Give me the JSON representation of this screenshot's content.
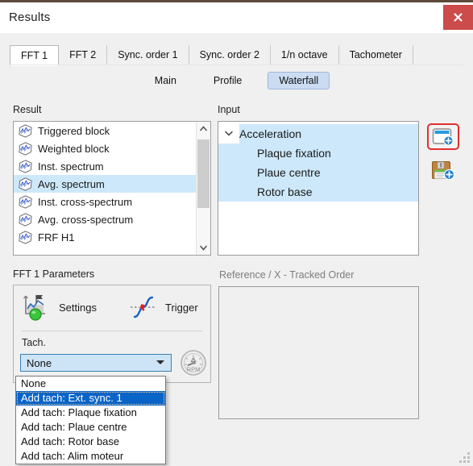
{
  "window": {
    "title": "Results",
    "close_label": "✖",
    "close_icon": "close-icon",
    "accent_red": "#cc4b4b",
    "accent_blue": "#0a64c8",
    "selection_blue": "#cde8fa"
  },
  "tabs": [
    {
      "label": "FFT 1",
      "active": true
    },
    {
      "label": "FFT 2",
      "active": false
    },
    {
      "label": "Sync. order 1",
      "active": false
    },
    {
      "label": "Sync. order 2",
      "active": false
    },
    {
      "label": "1/n octave",
      "active": false
    },
    {
      "label": "Tachometer",
      "active": false
    }
  ],
  "subtabs": [
    {
      "label": "Main",
      "active": false
    },
    {
      "label": "Profile",
      "active": false
    },
    {
      "label": "Waterfall",
      "active": true
    }
  ],
  "result": {
    "label": "Result",
    "items": [
      {
        "label": "Triggered block",
        "selected": false
      },
      {
        "label": "Weighted block",
        "selected": false
      },
      {
        "label": "Inst. spectrum",
        "selected": false
      },
      {
        "label": "Avg. spectrum",
        "selected": true
      },
      {
        "label": "Inst. cross-spectrum",
        "selected": false
      },
      {
        "label": "Avg. cross-spectrum",
        "selected": false
      },
      {
        "label": "FRF H1",
        "selected": false
      }
    ],
    "scroll_up_icon": "chevron-up-icon",
    "scroll_down_icon": "chevron-down-icon"
  },
  "input": {
    "label": "Input",
    "tree": {
      "root": {
        "label": "Acceleration",
        "expanded": true,
        "selected": true,
        "twisty_icon": "chevron-down-icon"
      },
      "children": [
        {
          "label": "Plaque fixation",
          "selected": true
        },
        {
          "label": "Plaue centre",
          "selected": true
        },
        {
          "label": "Rotor base",
          "selected": true
        }
      ]
    },
    "buttons": [
      {
        "name": "add-display-button",
        "icon": "add-window-icon",
        "highlighted": true
      },
      {
        "name": "save-button",
        "icon": "save-add-icon",
        "highlighted": false
      }
    ]
  },
  "parameters": {
    "label": "FFT 1  Parameters",
    "settings": {
      "label": "Settings",
      "icon": "settings-chart-icon"
    },
    "trigger": {
      "label": "Trigger",
      "icon": "trigger-curve-icon"
    },
    "tach": {
      "label": "Tach.",
      "value": "None",
      "arrow_icon": "chevron-down-icon",
      "rpm_button_icon": "rpm-gauge-icon",
      "rpm_button_label": "RPM",
      "options": [
        {
          "label": "None",
          "selected": false
        },
        {
          "label": "Add tach: Ext. sync. 1",
          "selected": true
        },
        {
          "label": "Add tach: Plaque fixation",
          "selected": false
        },
        {
          "label": "Add tach: Plaue centre",
          "selected": false
        },
        {
          "label": "Add tach: Rotor base",
          "selected": false
        },
        {
          "label": "Add tach: Alim moteur",
          "selected": false
        }
      ]
    }
  },
  "reference": {
    "label": "Reference / X   -   Tracked Order"
  },
  "resize_grip": {
    "icon": "resize-grip-icon"
  }
}
